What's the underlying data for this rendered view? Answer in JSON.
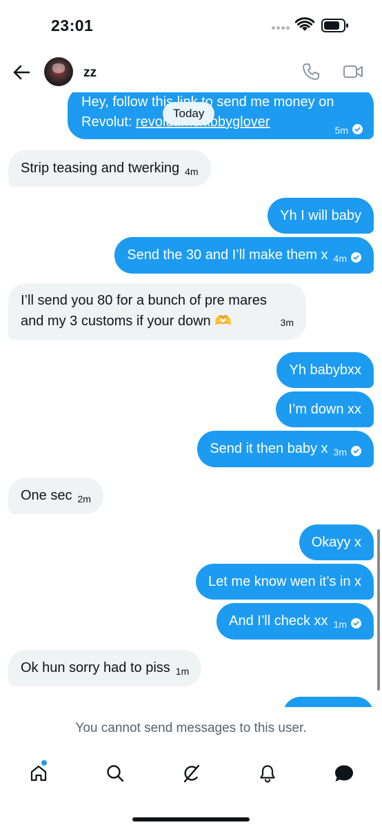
{
  "status_bar": {
    "time": "23:01"
  },
  "header": {
    "contact_name": "zz"
  },
  "date_separator": "Today",
  "messages": [
    {
      "direction": "out",
      "line1": "Hey, follow this link to send me money on",
      "line2_prefix": "Revolut: ",
      "link": "revolut.me/libbyglover",
      "time": "5m",
      "read": true
    },
    {
      "direction": "in",
      "text": "Strip teasing and twerking",
      "time": "4m"
    },
    {
      "direction": "out",
      "text": "Yh I will baby"
    },
    {
      "direction": "out",
      "text": "Send the 30 and I’ll make them x",
      "time": "4m",
      "read": true
    },
    {
      "direction": "in",
      "line1": "I’ll send you 80 for a bunch of pre mares",
      "line2": "and my 3 customs if your down 🫶",
      "time": "3m"
    },
    {
      "direction": "out",
      "text": "Yh babybxx"
    },
    {
      "direction": "out",
      "text": "I’m down xx"
    },
    {
      "direction": "out",
      "text": "Send it then baby x",
      "time": "3m",
      "read": true
    },
    {
      "direction": "in",
      "text": "One sec",
      "time": "2m"
    },
    {
      "direction": "out",
      "text": "Okayy x"
    },
    {
      "direction": "out",
      "text": "Let me know wen it’s in x"
    },
    {
      "direction": "out",
      "text": "And I’ll check xx",
      "time": "1m",
      "read": true
    },
    {
      "direction": "in",
      "text": "Ok hun sorry had to piss",
      "time": "1m"
    }
  ],
  "footer_notice": "You cannot send messages to this user.",
  "tab_bar": {
    "items": [
      "home-icon",
      "search-icon",
      "grok-icon",
      "notifications-icon",
      "messages-icon"
    ],
    "home_has_badge": true
  },
  "colors": {
    "accent": "#1d9bf0",
    "incoming_bubble": "#eff3f4",
    "muted_text": "#536471"
  }
}
